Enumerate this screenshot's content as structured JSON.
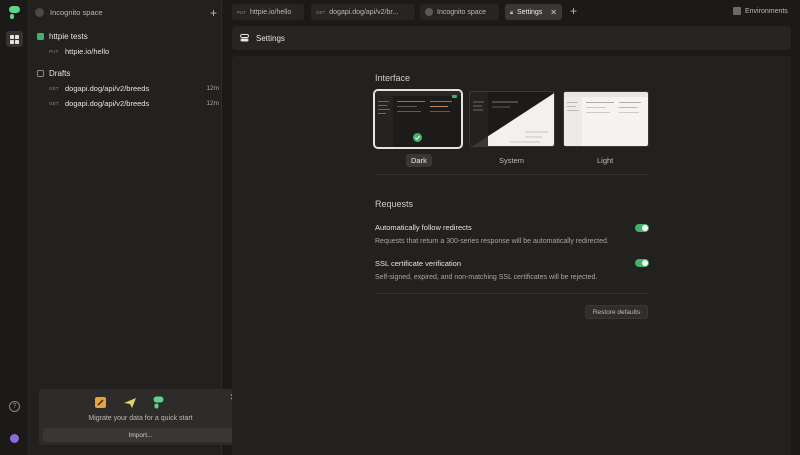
{
  "sidebar": {
    "space_name": "Incognito space",
    "collections": [
      {
        "name": "httpie tests",
        "requests": [
          {
            "method": "PUT",
            "url": "httpie.io/hello",
            "time": ""
          }
        ]
      },
      {
        "name": "Drafts",
        "requests": [
          {
            "method": "GET",
            "url": "dogapi.dog/api/v2/breeds",
            "time": "12m"
          },
          {
            "method": "GET",
            "url": "dogapi.dog/api/v2/breeds",
            "time": "12m"
          }
        ]
      }
    ],
    "promo": {
      "message": "Migrate your data for a quick start",
      "import_label": "Import..."
    }
  },
  "tabs": [
    {
      "method": "PUT",
      "label": "httpie.io/hello"
    },
    {
      "method": "GET",
      "label": "dogapi.dog/api/v2/br..."
    },
    {
      "method": "",
      "label": "Incognito space"
    },
    {
      "method": "",
      "label": "Settings",
      "active": true
    }
  ],
  "environments_label": "Environments",
  "settings": {
    "header_title": "Settings",
    "interface": {
      "title": "Interface",
      "themes": [
        {
          "label": "Dark",
          "selected": true
        },
        {
          "label": "System",
          "selected": false
        },
        {
          "label": "Light",
          "selected": false
        }
      ]
    },
    "requests": {
      "title": "Requests",
      "options": [
        {
          "title": "Automatically follow redirects",
          "description": "Requests that return a 300-series response will be automatically redirected.",
          "enabled": true
        },
        {
          "title": "SSL certificate verification",
          "description": "Self-signed, expired, and non-matching SSL certificates will be rejected.",
          "enabled": true
        }
      ]
    },
    "restore_label": "Restore defaults"
  },
  "colors": {
    "accent_green": "#3fb36a",
    "background": "#1b1a19",
    "panel": "#222120",
    "collection_green": "#3fb36a"
  }
}
